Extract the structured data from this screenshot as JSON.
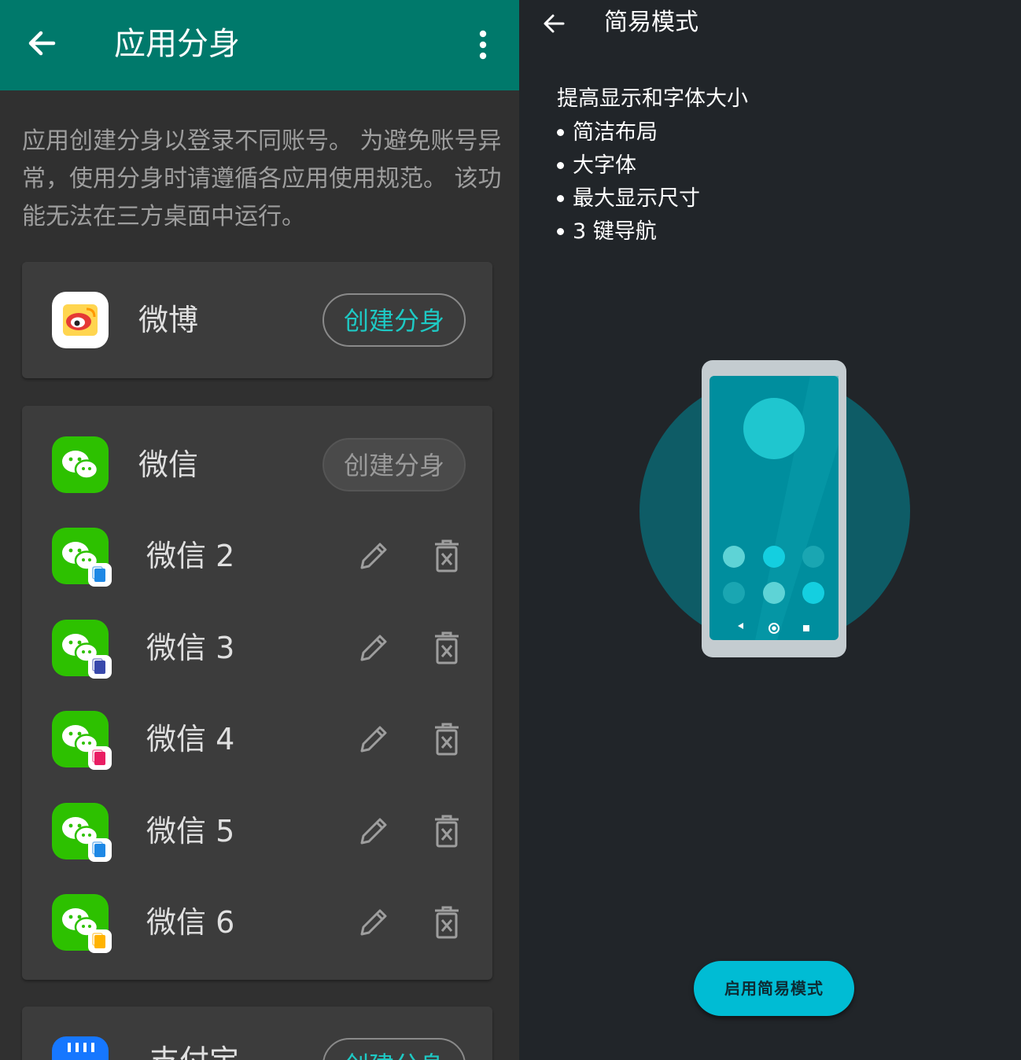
{
  "left": {
    "appbar": {
      "title": "应用分身"
    },
    "description": "应用创建分身以登录不同账号。 为避免账号异常，使用分身时请遵循各应用使用规范。 该功能无法在三方桌面中运行。",
    "weibo": {
      "name": "微博",
      "button": "创建分身"
    },
    "wechat": {
      "name": "微信",
      "button": "创建分身"
    },
    "clones": [
      {
        "name": "微信 2",
        "badge_color": "#1e88e5"
      },
      {
        "name": "微信 3",
        "badge_color": "#3949ab"
      },
      {
        "name": "微信 4",
        "badge_color": "#e91e63"
      },
      {
        "name": "微信 5",
        "badge_color": "#1e88e5"
      },
      {
        "name": "微信 6",
        "badge_color": "#ffb300"
      }
    ],
    "alipay": {
      "name": "支付宝",
      "button": "创建分身"
    },
    "colors": {
      "appbar": "#00796b",
      "accent": "#1ec9c4",
      "wechat_green": "#2dc100"
    }
  },
  "right": {
    "title": "简易模式",
    "intro": "提高显示和字体大小",
    "bullets": [
      "简洁布局",
      "大字体",
      "最大显示尺寸",
      "3 键导航"
    ],
    "enable_button": "启用简易模式",
    "colors": {
      "accent": "#00bcd4"
    }
  },
  "icons": [
    "back-arrow-icon",
    "more-vert-icon",
    "weibo-icon",
    "wechat-icon",
    "edit-pencil-icon",
    "delete-trash-icon",
    "alipay-icon",
    "phone-illustration"
  ]
}
